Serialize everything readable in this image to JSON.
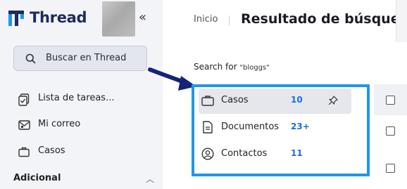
{
  "app": {
    "brand": "Thread"
  },
  "sidebar": {
    "search_label": "Buscar en Thread",
    "items": [
      {
        "label": "Lista de tareas...",
        "icon": "tasks-icon"
      },
      {
        "label": "Mi correo",
        "icon": "mail-icon"
      },
      {
        "label": "Casos",
        "icon": "briefcase-icon"
      }
    ],
    "section_label": "Adicional"
  },
  "breadcrumb": {
    "home": "Inicio"
  },
  "page": {
    "title": "Resultado de búsqueda"
  },
  "search": {
    "prefix": "Search for",
    "query": "\"bloggs\""
  },
  "results": [
    {
      "label": "Casos",
      "count": "10",
      "icon": "briefcase-icon",
      "pinned": true
    },
    {
      "label": "Documentos",
      "count": "23+",
      "icon": "document-icon",
      "pinned": false
    },
    {
      "label": "Contactos",
      "count": "11",
      "icon": "contact-icon",
      "pinned": false
    }
  ],
  "colors": {
    "brand": "#1f2b5c",
    "accent": "#1f97e8",
    "count": "#1d6fd6",
    "arrow": "#14237a"
  }
}
